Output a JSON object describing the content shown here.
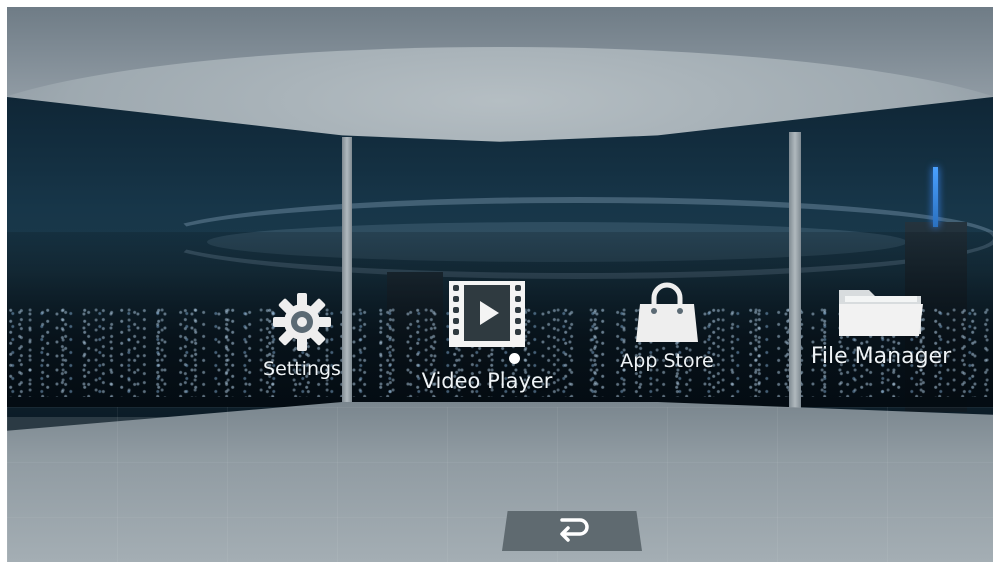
{
  "apps": [
    {
      "id": "settings",
      "label": "Settings",
      "icon": "gear-icon"
    },
    {
      "id": "video_player",
      "label": "Video Player",
      "icon": "video-player-icon",
      "focused": true
    },
    {
      "id": "app_store",
      "label": "App Store",
      "icon": "shopping-bag-icon"
    },
    {
      "id": "file_manager",
      "label": "File Manager",
      "icon": "folder-icon"
    }
  ],
  "back_button": {
    "icon": "return-arrow-icon"
  },
  "colors": {
    "icon_fill": "#eeeeee",
    "label_text": "#eef3f6",
    "back_pad": "#5f6a70",
    "spire": "#4aa0ff"
  }
}
